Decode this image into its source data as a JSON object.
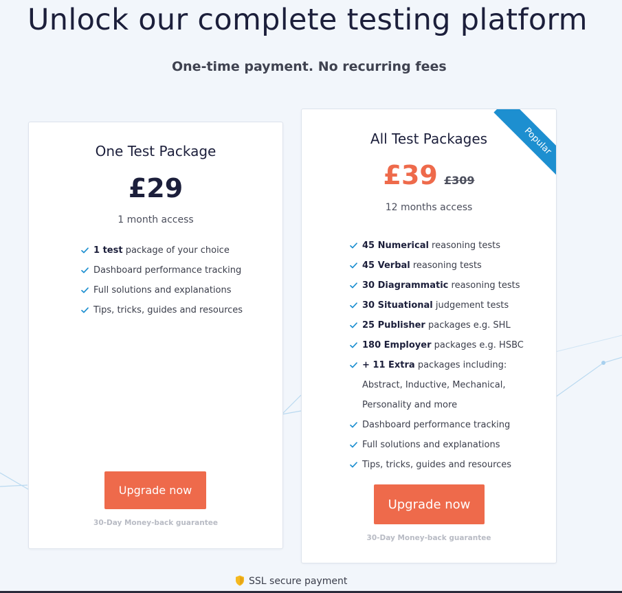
{
  "header": {
    "title": "Unlock our complete testing platform",
    "subtitle": "One-time payment. No recurring fees"
  },
  "colors": {
    "accent": "#ee6a4b",
    "ribbon": "#1d8fd0",
    "check": "#1d8fd0",
    "navy": "#1c1f3b"
  },
  "plans": [
    {
      "title": "One Test Package",
      "price": "£29",
      "access": "1 month access",
      "features": [
        {
          "bold": "1 test",
          "text": " package of your choice"
        },
        {
          "bold": "",
          "text": "Dashboard performance tracking"
        },
        {
          "bold": "",
          "text": "Full solutions and explanations"
        },
        {
          "bold": "",
          "text": "Tips, tricks, guides and resources"
        }
      ],
      "cta": "Upgrade now",
      "guarantee": "30-Day Money-back guarantee"
    },
    {
      "title": "All Test Packages",
      "price": "£39",
      "old_price": "£309",
      "access": "12 months access",
      "ribbon": "Popular",
      "features": [
        {
          "bold": "45 Numerical",
          "text": " reasoning tests"
        },
        {
          "bold": "45 Verbal",
          "text": " reasoning tests"
        },
        {
          "bold": "30 Diagrammatic",
          "text": " reasoning tests"
        },
        {
          "bold": "30 Situational",
          "text": " judgement tests"
        },
        {
          "bold": "25 Publisher",
          "text": " packages e.g. SHL"
        },
        {
          "bold": "180 Employer",
          "text": " packages e.g. HSBC"
        },
        {
          "bold": "+ 11 Extra",
          "text": " packages including:",
          "continuation": [
            "Abstract, Inductive, Mechanical,",
            "Personality and more"
          ]
        },
        {
          "bold": "",
          "text": "Dashboard performance tracking"
        },
        {
          "bold": "",
          "text": "Full solutions and explanations"
        },
        {
          "bold": "",
          "text": "Tips, tricks, guides and resources"
        }
      ],
      "cta": "Upgrade now",
      "guarantee": "30-Day Money-back guarantee"
    }
  ],
  "footer": {
    "ssl_label": "SSL secure payment",
    "ssl_icon": "shield-icon"
  }
}
